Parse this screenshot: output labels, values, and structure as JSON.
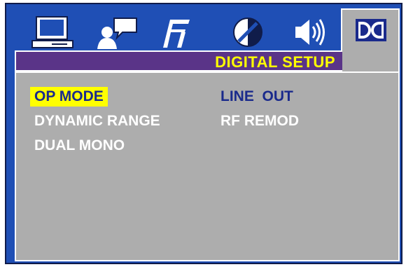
{
  "tabs": [
    {
      "icon": "monitor-icon"
    },
    {
      "icon": "language-icon"
    },
    {
      "icon": "music-note-icon"
    },
    {
      "icon": "picture-icon"
    },
    {
      "icon": "speaker-icon"
    },
    {
      "icon": "dolby-digital-icon"
    }
  ],
  "title": "DIGITAL SETUP",
  "menu": {
    "items": [
      "OP MODE",
      "DYNAMIC RANGE",
      "DUAL MONO"
    ],
    "selected_index": 0
  },
  "options": [
    "LINE  OUT",
    "RF REMOD"
  ],
  "colors": {
    "frame": "#1f4fb5",
    "title_bar": "#5a3488",
    "panel": "#adadad",
    "highlight": "#ffff00",
    "value_text": "#1a2a8c"
  }
}
